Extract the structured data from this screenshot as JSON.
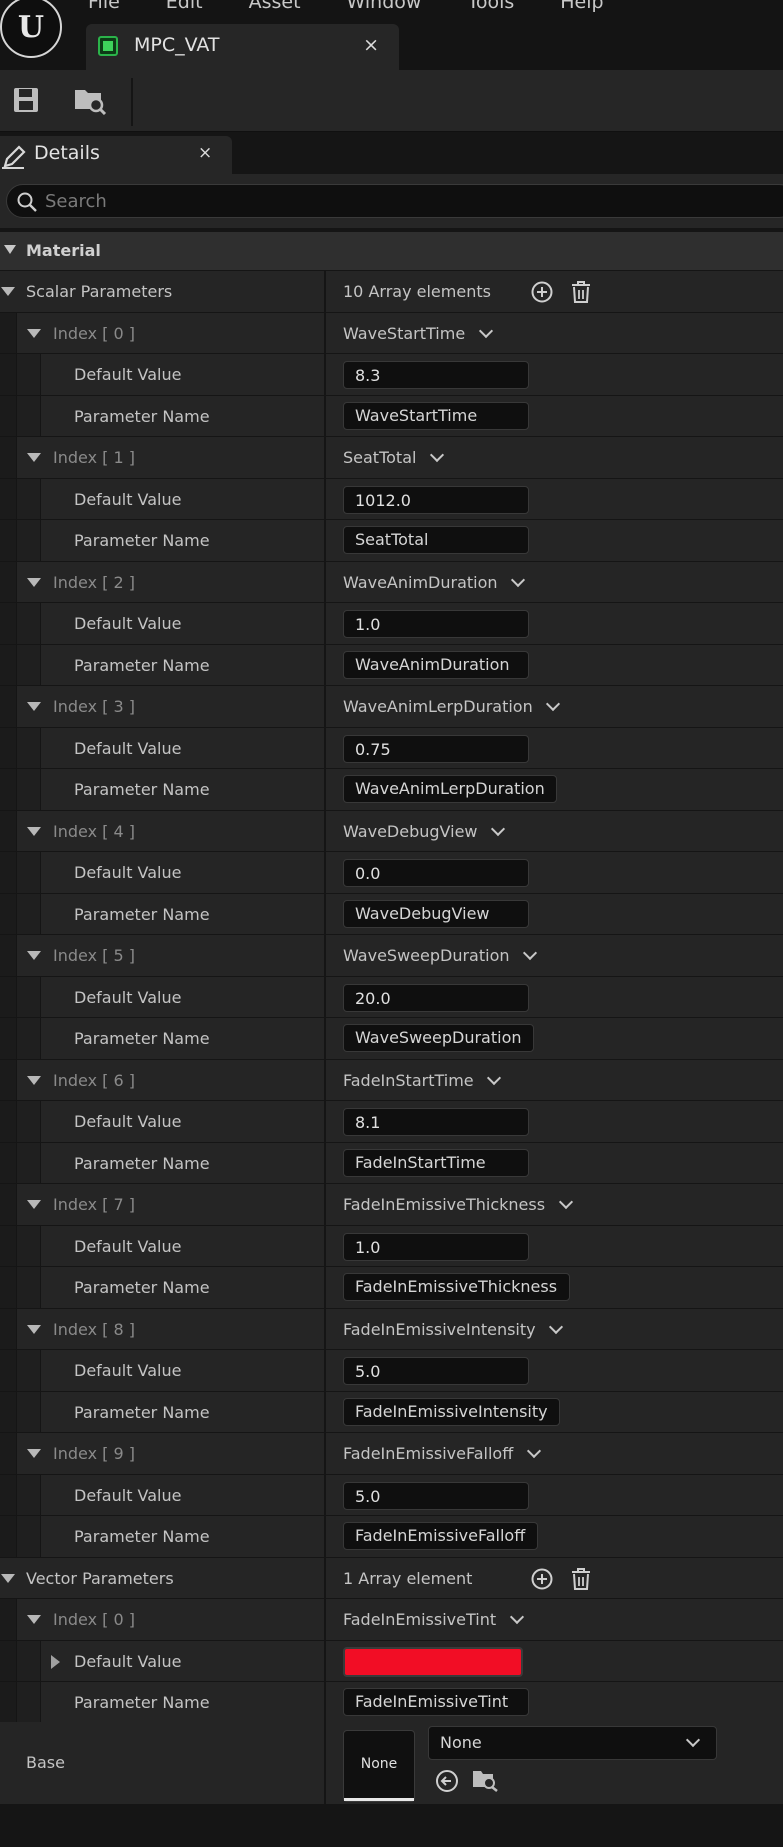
{
  "menu": [
    "File",
    "Edit",
    "Asset",
    "Window",
    "Tools",
    "Help"
  ],
  "asset_tab": {
    "label": "MPC_VAT",
    "close": "×"
  },
  "details_tab": {
    "label": "Details",
    "close": "×"
  },
  "search": {
    "placeholder": "Search",
    "value": ""
  },
  "category": {
    "label": "Material"
  },
  "scalar": {
    "label": "Scalar Parameters",
    "count": "10 Array elements",
    "items": [
      {
        "index": "Index [ 0 ]",
        "name": "WaveStartTime",
        "default_label": "Default Value",
        "default": "8.3",
        "param_label": "Parameter Name"
      },
      {
        "index": "Index [ 1 ]",
        "name": "SeatTotal",
        "default_label": "Default Value",
        "default": "1012.0",
        "param_label": "Parameter Name"
      },
      {
        "index": "Index [ 2 ]",
        "name": "WaveAnimDuration",
        "default_label": "Default Value",
        "default": "1.0",
        "param_label": "Parameter Name"
      },
      {
        "index": "Index [ 3 ]",
        "name": "WaveAnimLerpDuration",
        "default_label": "Default Value",
        "default": "0.75",
        "param_label": "Parameter Name"
      },
      {
        "index": "Index [ 4 ]",
        "name": "WaveDebugView",
        "default_label": "Default Value",
        "default": "0.0",
        "param_label": "Parameter Name"
      },
      {
        "index": "Index [ 5 ]",
        "name": "WaveSweepDuration",
        "default_label": "Default Value",
        "default": "20.0",
        "param_label": "Parameter Name"
      },
      {
        "index": "Index [ 6 ]",
        "name": "FadeInStartTime",
        "default_label": "Default Value",
        "default": "8.1",
        "param_label": "Parameter Name"
      },
      {
        "index": "Index [ 7 ]",
        "name": "FadeInEmissiveThickness",
        "default_label": "Default Value",
        "default": "1.0",
        "param_label": "Parameter Name"
      },
      {
        "index": "Index [ 8 ]",
        "name": "FadeInEmissiveIntensity",
        "default_label": "Default Value",
        "default": "5.0",
        "param_label": "Parameter Name"
      },
      {
        "index": "Index [ 9 ]",
        "name": "FadeInEmissiveFalloff",
        "default_label": "Default Value",
        "default": "5.0",
        "param_label": "Parameter Name"
      }
    ]
  },
  "vector": {
    "label": "Vector Parameters",
    "count": "1 Array element",
    "items": [
      {
        "index": "Index [ 0 ]",
        "name": "FadeInEmissiveTint",
        "default_label": "Default Value",
        "color": "#f20d25",
        "param_label": "Parameter Name"
      }
    ]
  },
  "base": {
    "label": "Base",
    "thumb": "None",
    "combo": "None"
  },
  "colors": {
    "accent_green": "#2bb34a",
    "tint": "#f20d25"
  }
}
